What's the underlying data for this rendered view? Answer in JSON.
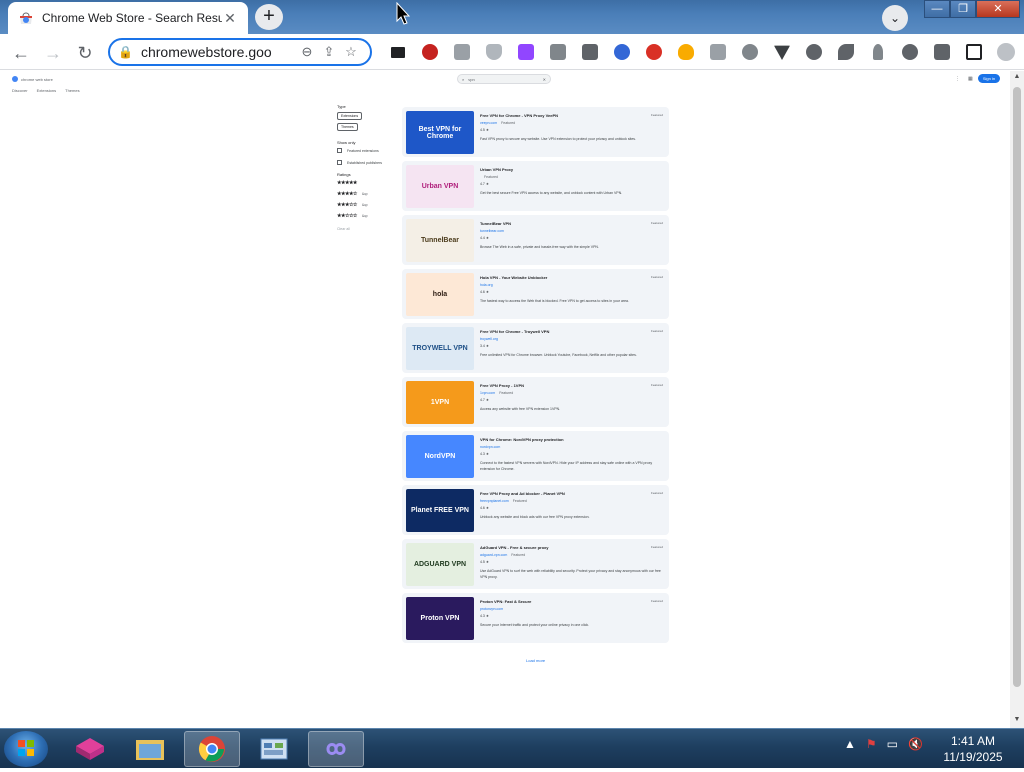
{
  "browser": {
    "tab_title": "Chrome Web Store - Search Resu",
    "tab_close": "✕",
    "new_tab": "+",
    "url": "chromewebstore.goo",
    "window_min": "—",
    "window_max": "❐",
    "window_close": "✕"
  },
  "cws": {
    "logo_text": "chrome web store",
    "nav": [
      "Discover",
      "Extensions",
      "Themes"
    ],
    "search_value": "vpn",
    "signin": "Sign in"
  },
  "filters": {
    "type_label": "Type",
    "type_chips": [
      "Extensions",
      "Themes"
    ],
    "show_label": "Show only",
    "checks": [
      "Featured extensions",
      "Established publishers"
    ],
    "rating_label": "Ratings",
    "ratings": [
      {
        "stars": "★★★★★",
        "suffix": ""
      },
      {
        "stars": "★★★★☆",
        "suffix": "& up"
      },
      {
        "stars": "★★★☆☆",
        "suffix": "& up"
      },
      {
        "stars": "★★☆☆☆",
        "suffix": "& up"
      }
    ],
    "clear": "Clear all"
  },
  "results": [
    {
      "title": "Free VPN for Chrome - VPN Proxy VeePN",
      "featured": "Featured",
      "publisher": "veepn.com",
      "badge": "Featured",
      "rating": "4.5 ★",
      "desc": "Fast VPN proxy to secure any website. Use VPN extension to protect your privacy and unblock sites.",
      "thumb": "Best VPN for Chrome",
      "thumb_bg": "#1e57c8",
      "thumb_fg": "#ffffff"
    },
    {
      "title": "Urban VPN Proxy",
      "featured": "",
      "publisher": "",
      "badge": "Featured",
      "rating": "4.7 ★",
      "desc": "Get the best secure Free VPN access to any website, and unblock content with Urban VPN.",
      "thumb": "Urban VPN",
      "thumb_bg": "#f5e4f2",
      "thumb_fg": "#b01f7c"
    },
    {
      "title": "TunnelBear VPN",
      "featured": "Featured",
      "publisher": "tunnelbear.com",
      "badge": "",
      "rating": "4.4 ★",
      "desc": "Browse The Web in a safe, private and hassle-free way with the simple VPN.",
      "thumb": "TunnelBear",
      "thumb_bg": "#f4efe6",
      "thumb_fg": "#4a3a1a"
    },
    {
      "title": "Hola VPN - Your Website Unblocker",
      "featured": "Featured",
      "publisher": "hola.org",
      "badge": "",
      "rating": "4.6 ★",
      "desc": "The fastest way to access the Web that is blocked. Free VPN to get access to sites in your area.",
      "thumb": "hola",
      "thumb_bg": "#fde8d6",
      "thumb_fg": "#2b1a10"
    },
    {
      "title": "Free VPN for Chrome - Troywell VPN",
      "featured": "Featured",
      "publisher": "troywell.org",
      "badge": "",
      "rating": "3.4 ★",
      "desc": "Free unlimited VPN for Chrome browser. Unblock Youtube, Facebook, Netflix and other popular sites.",
      "thumb": "TROYWELL VPN",
      "thumb_bg": "#dde9f4",
      "thumb_fg": "#1d4f86"
    },
    {
      "title": "Free VPN Proxy - 1VPN",
      "featured": "Featured",
      "publisher": "1vpn.com",
      "badge": "Featured",
      "rating": "4.7 ★",
      "desc": "Access any website with free VPN extension 1VPN.",
      "thumb": "1VPN",
      "thumb_bg": "#f59a1b",
      "thumb_fg": "#ffffff"
    },
    {
      "title": "VPN for Chrome: NordVPN proxy protection",
      "featured": "",
      "publisher": "nordvpn.com",
      "badge": "",
      "rating": "4.3 ★",
      "desc": "Connect to the fastest VPN servers with NordVPN. Hide your IP address and stay safe online with a VPN proxy extension for Chrome.",
      "thumb": "NordVPN",
      "thumb_bg": "#4687ff",
      "thumb_fg": "#ffffff"
    },
    {
      "title": "Free VPN Proxy and Ad blocker - Planet VPN",
      "featured": "Featured",
      "publisher": "freevpnplanet.com",
      "badge": "Featured",
      "rating": "4.6 ★",
      "desc": "Unblock any website and block ads with our free VPN proxy extension.",
      "thumb": "Planet FREE VPN",
      "thumb_bg": "#0d2a63",
      "thumb_fg": "#ffffff"
    },
    {
      "title": "AdGuard VPN - Free & secure proxy",
      "featured": "Featured",
      "publisher": "adguard-vpn.com",
      "badge": "Featured",
      "rating": "4.5 ★",
      "desc": "Use AdGuard VPN to surf the web with reliability and security. Protect your privacy and stay anonymous with our free VPN proxy.",
      "thumb": "ADGUARD VPN",
      "thumb_bg": "#e4efe0",
      "thumb_fg": "#1f3a1f"
    },
    {
      "title": "Proton VPN: Fast & Secure",
      "featured": "Featured",
      "publisher": "protonvpn.com",
      "badge": "",
      "rating": "4.3 ★",
      "desc": "Secure your Internet traffic and protect your online privacy in one click.",
      "thumb": "Proton VPN",
      "thumb_bg": "#2a1a5e",
      "thumb_fg": "#ffffff"
    }
  ],
  "load_more": "Load more",
  "taskbar": {
    "time": "1:41 AM",
    "date": "11/19/2025"
  }
}
